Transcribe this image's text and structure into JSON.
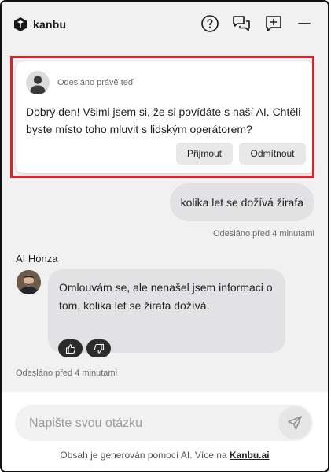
{
  "header": {
    "brand": "kanbu",
    "icons": [
      "help-icon",
      "conversations-icon",
      "new-chat-icon",
      "minimize-icon"
    ]
  },
  "offer": {
    "meta": "Odesláno právě teď",
    "text": "Dobrý den! Všiml jsem si, že si povídáte s naší AI. Chtěli byste místo toho mluvit s lidským operátorem?",
    "accept_label": "Přijmout",
    "decline_label": "Odmítnout"
  },
  "user_message": {
    "text": "kolika let se dožívá žirafa",
    "meta": "Odesláno před 4 minutami"
  },
  "ai_message": {
    "sender": "AI Honza",
    "text": "Omlouvám se, ale nenašel jsem informaci o tom, kolika let se žirafa dožívá.",
    "meta": "Odesláno před 4 minutami"
  },
  "composer": {
    "placeholder": "Napište svou otázku"
  },
  "disclaimer": {
    "prefix": "Obsah je generován pomocí AI. Více na ",
    "link_text": "Kanbu.ai"
  },
  "colors": {
    "highlight": "#e0202a",
    "background": "#f1f1f2",
    "bubble": "#e2e2e4",
    "rate_button": "#2b2b2b"
  }
}
